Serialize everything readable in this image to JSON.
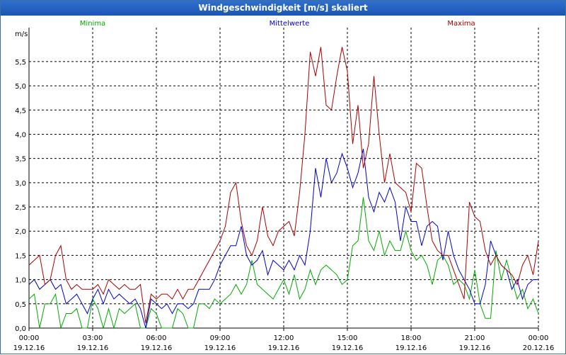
{
  "window": {
    "title": "Windgeschwindigkeit [m/s] skaliert"
  },
  "chart_data": {
    "type": "line",
    "title": "Windgeschwindigkeit [m/s] skaliert",
    "ylabel": "m/s",
    "ylim": [
      0,
      6.2
    ],
    "yticks": [
      "0,0",
      "0,5",
      "1,0",
      "1,5",
      "2,0",
      "2,5",
      "3,0",
      "3,5",
      "4,0",
      "4,5",
      "5,0",
      "5,5"
    ],
    "yticks_values": [
      0,
      0.5,
      1,
      1.5,
      2,
      2.5,
      3,
      3.5,
      4,
      4.5,
      5,
      5.5
    ],
    "xlim": [
      0,
      24
    ],
    "xticks": [
      {
        "time": "00:00",
        "date": "19.12.16"
      },
      {
        "time": "03:00",
        "date": "19.12.16"
      },
      {
        "time": "06:00",
        "date": "19.12.16"
      },
      {
        "time": "09:00",
        "date": "19.12.16"
      },
      {
        "time": "12:00",
        "date": "19.12.16"
      },
      {
        "time": "15:00",
        "date": "19.12.16"
      },
      {
        "time": "18:00",
        "date": "19.12.16"
      },
      {
        "time": "21:00",
        "date": "19.12.16"
      },
      {
        "time": "00:00",
        "date": "20.12.16"
      }
    ],
    "xticks_hours": [
      0,
      3,
      6,
      9,
      12,
      15,
      18,
      21,
      24
    ],
    "grid": true,
    "legend_position": "top",
    "x_hours": [
      0,
      0.25,
      0.5,
      0.75,
      1,
      1.25,
      1.5,
      1.75,
      2,
      2.25,
      2.5,
      2.75,
      3,
      3.25,
      3.5,
      3.75,
      4,
      4.25,
      4.5,
      4.75,
      5,
      5.25,
      5.5,
      5.75,
      6,
      6.25,
      6.5,
      6.75,
      7,
      7.25,
      7.5,
      7.75,
      8,
      8.25,
      8.5,
      8.75,
      9,
      9.25,
      9.5,
      9.75,
      10,
      10.25,
      10.5,
      10.75,
      11,
      11.25,
      11.5,
      11.75,
      12,
      12.25,
      12.5,
      12.75,
      13,
      13.25,
      13.5,
      13.75,
      14,
      14.25,
      14.5,
      14.75,
      15,
      15.25,
      15.5,
      15.75,
      16,
      16.25,
      16.5,
      16.75,
      17,
      17.25,
      17.5,
      17.75,
      18,
      18.25,
      18.5,
      18.75,
      19,
      19.25,
      19.5,
      19.75,
      20,
      20.25,
      20.5,
      20.75,
      21,
      21.25,
      21.5,
      21.75,
      22,
      22.25,
      22.5,
      22.75,
      23,
      23.25,
      23.5,
      23.75,
      24
    ],
    "series": [
      {
        "name": "Minima",
        "color": "#00aa00",
        "legend_align": "left",
        "values": [
          0.6,
          0.7,
          0.0,
          0.5,
          0.5,
          0.7,
          0.0,
          0.3,
          0.3,
          0.4,
          0.0,
          0.0,
          0.6,
          0.4,
          0.0,
          0.4,
          0.0,
          0.4,
          0.3,
          0.4,
          0.5,
          0.0,
          0.0,
          0.4,
          0.3,
          0.0,
          0.0,
          0.0,
          0.4,
          0.3,
          0.0,
          0.0,
          0.5,
          0.5,
          0.4,
          0.6,
          0.5,
          0.6,
          0.7,
          0.9,
          0.7,
          0.9,
          1.4,
          0.9,
          0.8,
          0.7,
          0.6,
          0.8,
          1.0,
          0.7,
          1.1,
          0.6,
          0.8,
          1.2,
          0.9,
          1.2,
          1.3,
          1.2,
          1.1,
          0.9,
          1.0,
          1.7,
          1.8,
          2.7,
          1.8,
          1.6,
          2.0,
          1.5,
          1.8,
          1.6,
          1.6,
          2.0,
          1.6,
          1.4,
          1.5,
          1.3,
          0.9,
          1.4,
          1.5,
          1.3,
          0.9,
          1.0,
          0.9,
          0.6,
          1.2,
          0.5,
          0.2,
          0.2,
          1.6,
          1.0,
          1.4,
          1.0,
          0.6,
          0.8,
          0.4,
          0.6,
          0.3,
          0.3
        ]
      },
      {
        "name": "Mittelwerte",
        "color": "#0000cc",
        "legend_align": "center",
        "values": [
          0.9,
          1.0,
          0.8,
          0.9,
          1.0,
          0.8,
          0.9,
          0.5,
          0.6,
          0.7,
          0.5,
          0.3,
          0.6,
          0.8,
          0.5,
          0.8,
          0.6,
          0.7,
          0.6,
          0.5,
          0.6,
          0.4,
          0.0,
          0.6,
          0.5,
          0.4,
          0.5,
          0.3,
          0.5,
          0.5,
          0.4,
          0.5,
          0.8,
          0.8,
          0.8,
          1.0,
          1.3,
          1.5,
          1.7,
          1.7,
          2.1,
          1.5,
          1.3,
          1.4,
          1.6,
          1.1,
          1.4,
          1.3,
          1.2,
          1.4,
          1.2,
          1.5,
          1.3,
          2.0,
          3.3,
          2.7,
          3.5,
          3.0,
          3.2,
          3.6,
          3.3,
          2.9,
          3.2,
          3.7,
          2.7,
          2.4,
          2.8,
          2.6,
          2.9,
          2.6,
          1.8,
          2.5,
          2.2,
          2.2,
          1.7,
          2.1,
          2.2,
          2.1,
          1.4,
          2.0,
          1.5,
          1.2,
          1.0,
          0.8,
          0.5,
          0.5,
          0.9,
          1.8,
          1.5,
          1.3,
          1.2,
          0.8,
          1.0,
          0.6,
          0.9,
          1.0,
          1.0,
          0.9
        ]
      },
      {
        "name": "Maxima",
        "color": "#aa0000",
        "legend_align": "right",
        "values": [
          1.3,
          1.4,
          1.5,
          0.9,
          1.0,
          1.5,
          1.7,
          1.0,
          0.8,
          0.9,
          0.8,
          0.8,
          0.8,
          0.9,
          0.7,
          1.0,
          0.9,
          0.8,
          0.9,
          0.8,
          0.8,
          0.9,
          0.1,
          0.7,
          0.6,
          0.7,
          0.7,
          0.6,
          0.8,
          0.6,
          0.8,
          0.8,
          1.0,
          1.2,
          1.4,
          1.6,
          1.8,
          2.1,
          2.8,
          3.0,
          2.2,
          1.7,
          1.5,
          1.8,
          2.5,
          1.9,
          1.7,
          2.0,
          2.1,
          2.2,
          1.9,
          2.8,
          4.0,
          5.7,
          5.2,
          5.8,
          4.6,
          4.5,
          5.2,
          5.8,
          5.3,
          3.8,
          4.6,
          3.3,
          3.8,
          5.2,
          4.0,
          3.0,
          3.6,
          3.0,
          2.9,
          2.8,
          2.4,
          3.4,
          3.3,
          2.5,
          1.8,
          1.6,
          1.5,
          1.5,
          1.2,
          0.9,
          0.6,
          2.6,
          2.3,
          2.2,
          1.6,
          1.3,
          1.5,
          1.3,
          1.2,
          1.1,
          0.9,
          1.3,
          1.5,
          1.1,
          1.8,
          1.3
        ]
      }
    ]
  }
}
